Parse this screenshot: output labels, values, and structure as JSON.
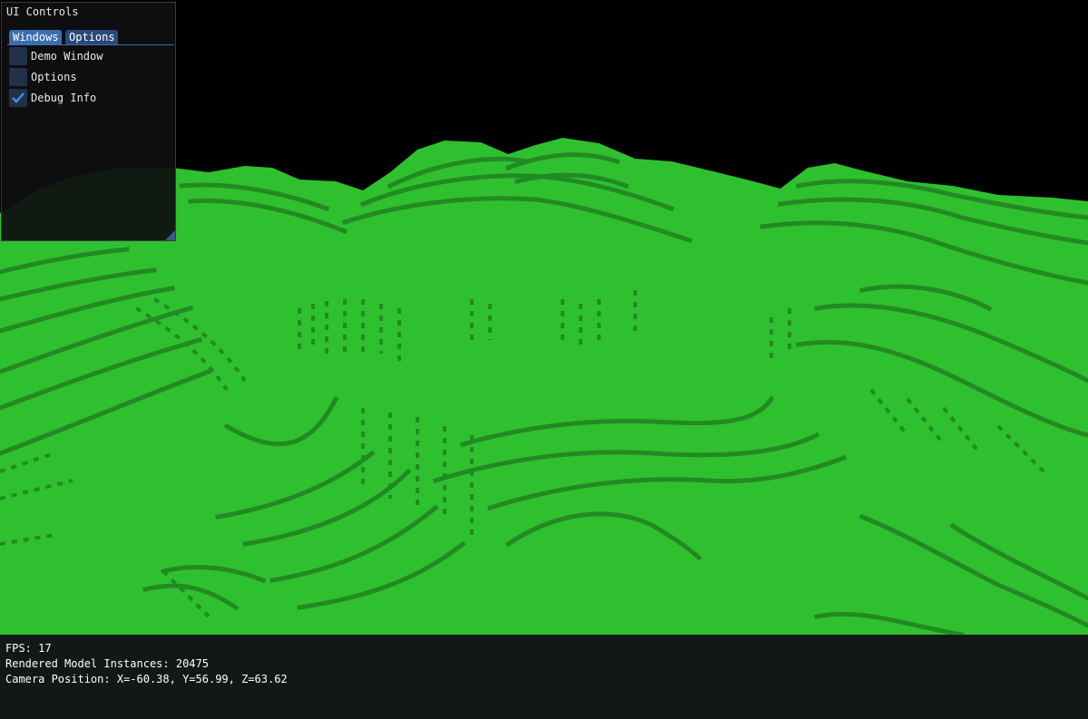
{
  "ui_window": {
    "title": "UI Controls",
    "tabs": [
      {
        "label": "Windows",
        "active": true
      },
      {
        "label": "Options",
        "active": false
      }
    ],
    "checkboxes": [
      {
        "label": "Demo Window",
        "checked": false
      },
      {
        "label": "Options",
        "checked": false
      },
      {
        "label": "Debug Info",
        "checked": true
      }
    ]
  },
  "debug": {
    "fps_line": "FPS: 17",
    "instances_line": "Rendered Model Instances: 20475",
    "camera_line": "Camera Position: X=-60.38, Y=56.99, Z=63.62"
  },
  "colors": {
    "terrain_top": "#2fc02f",
    "terrain_side": "#238a23",
    "sky": "#000000",
    "accent": "#3b6db0",
    "checkmark": "#4a90e8"
  },
  "icons": {
    "check": "checkmark-icon",
    "resize": "resize-grip-icon"
  }
}
